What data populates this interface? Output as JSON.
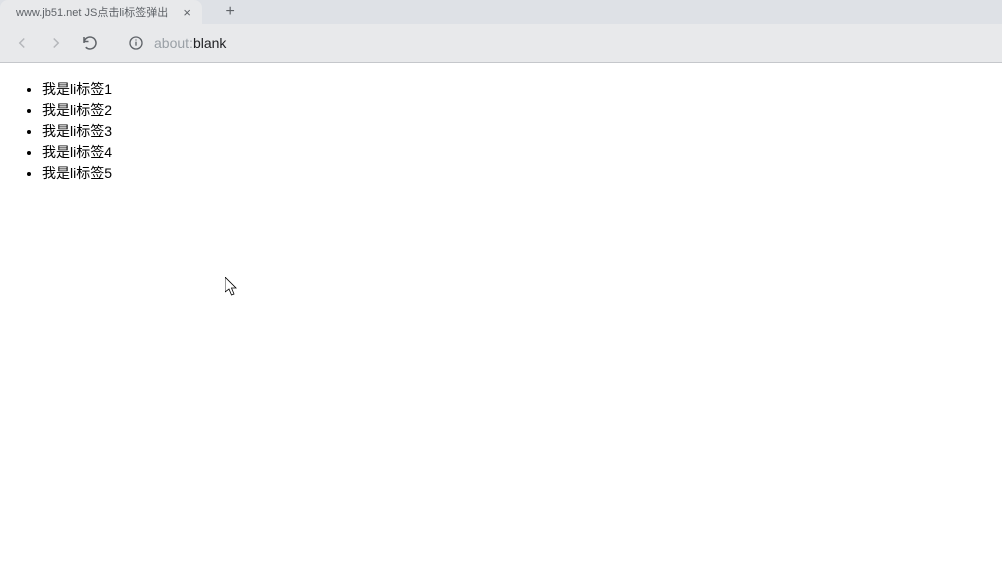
{
  "browser": {
    "tab_title": "www.jb51.net JS点击li标签弹出",
    "new_tab_label": "+",
    "close_tab_label": "×",
    "url_prefix": "about:",
    "url_suffix": "blank"
  },
  "page": {
    "list_items": [
      "我是li标签1",
      "我是li标签2",
      "我是li标签3",
      "我是li标签4",
      "我是li标签5"
    ]
  }
}
